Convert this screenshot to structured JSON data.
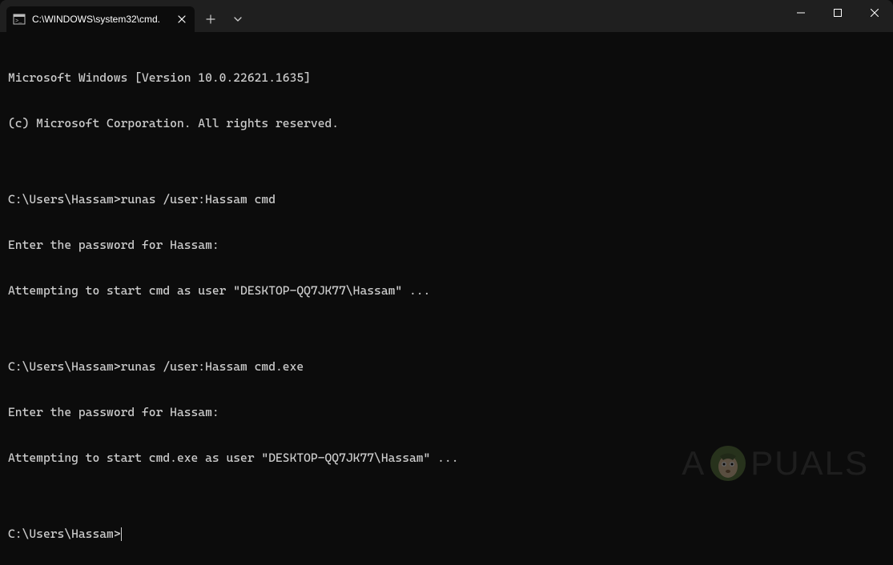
{
  "titlebar": {
    "tab_title": "C:\\WINDOWS\\system32\\cmd."
  },
  "terminal": {
    "lines": [
      "Microsoft Windows [Version 10.0.22621.1635]",
      "(c) Microsoft Corporation. All rights reserved.",
      "",
      "C:\\Users\\Hassam>runas /user:Hassam cmd",
      "Enter the password for Hassam:",
      "Attempting to start cmd as user \"DESKTOP-QQ7JK77\\Hassam\" ...",
      "",
      "C:\\Users\\Hassam>runas /user:Hassam cmd.exe",
      "Enter the password for Hassam:",
      "Attempting to start cmd.exe as user \"DESKTOP-QQ7JK77\\Hassam\" ...",
      ""
    ],
    "prompt": "C:\\Users\\Hassam>"
  },
  "watermark": {
    "prefix": "A",
    "suffix": "PUALS"
  }
}
